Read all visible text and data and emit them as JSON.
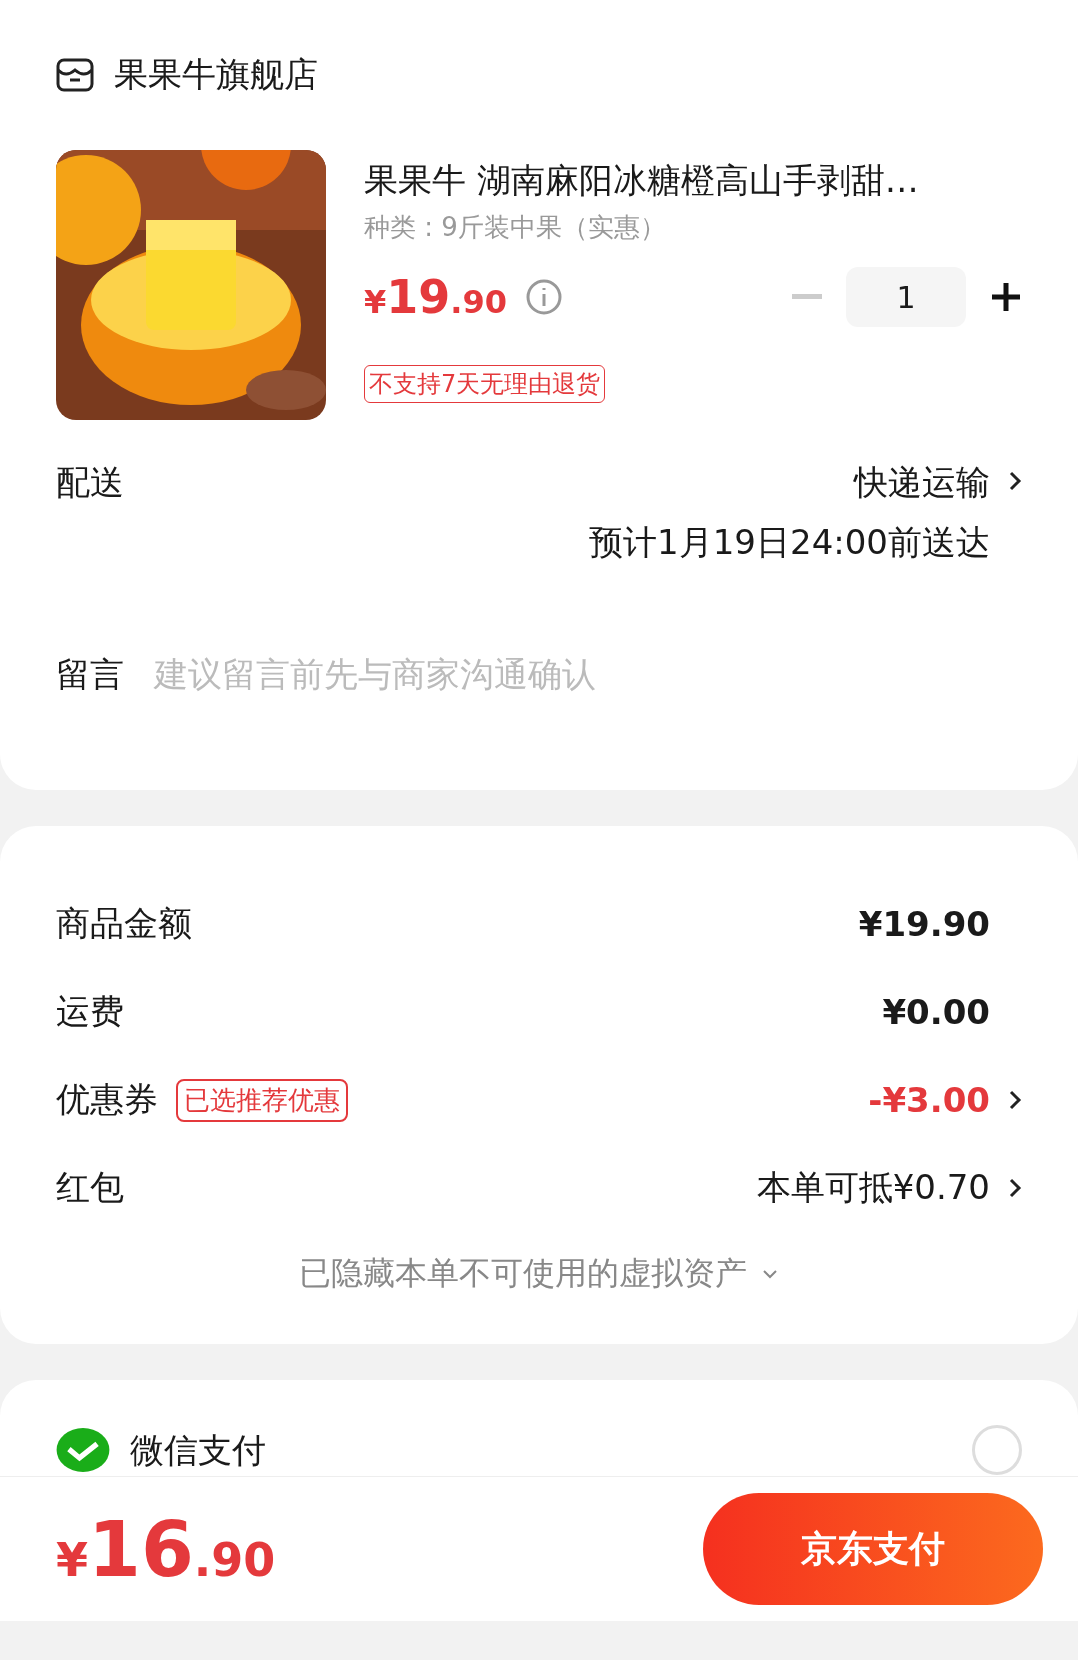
{
  "store": {
    "name": "果果牛旗舰店"
  },
  "product": {
    "title": "果果牛 湖南麻阳冰糖橙高山手剥甜…",
    "variant": "种类 : 9斤装中果（实惠）",
    "price": {
      "currency": "¥",
      "integer": "19",
      "decimal": ".90"
    },
    "quantity": "1",
    "tag": "不支持7天无理由退货"
  },
  "delivery": {
    "label": "配送",
    "method": "快递运输",
    "eta": "预计1月19日24:00前送达"
  },
  "message": {
    "label": "留言",
    "placeholder": "建议留言前先与商家沟通确认"
  },
  "summary": {
    "rows": [
      {
        "label": "商品金额",
        "value": "¥19.90",
        "kind": "plain"
      },
      {
        "label": "运费",
        "value": "¥0.00",
        "kind": "plain"
      },
      {
        "label": "优惠券",
        "badge": "已选推荐优惠",
        "value": "-¥3.00",
        "kind": "discount"
      },
      {
        "label": "红包",
        "value": "本单可抵¥0.70",
        "kind": "link"
      }
    ],
    "hidden_note": "已隐藏本单不可使用的虚拟资产"
  },
  "payment_methods": [
    {
      "name": "微信支付",
      "selected": false
    }
  ],
  "footer": {
    "total": {
      "currency": "¥",
      "integer": "16",
      "decimal": ".90"
    },
    "pay_button": "京东支付"
  }
}
